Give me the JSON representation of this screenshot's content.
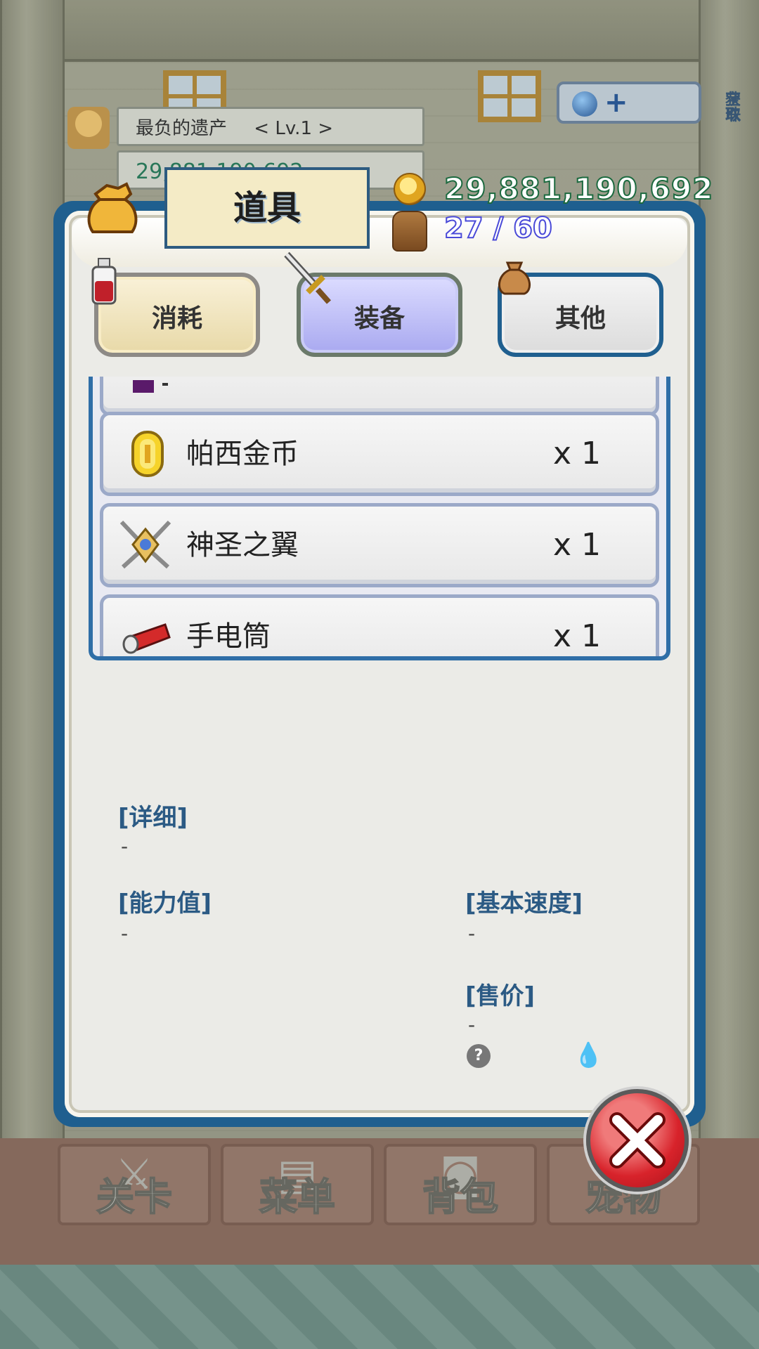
{
  "profile": {
    "title": "最负的遗产",
    "level": "< Lv.1 >",
    "gold_behind": "29,881,190,692"
  },
  "pearl_button": {
    "label_line1": "获取",
    "label_line2": "宝珠"
  },
  "dialog": {
    "title": "道具",
    "gold": "29,881,190,692",
    "capacity": "27 / 60"
  },
  "tabs": [
    {
      "label": "消耗",
      "state": "normal"
    },
    {
      "label": "装备",
      "state": "selected"
    },
    {
      "label": "其他",
      "state": "normal"
    }
  ],
  "items": [
    {
      "name": "帕西金币",
      "qty": "x 1",
      "icon": "gold-coin-icon"
    },
    {
      "name": "神圣之翼",
      "qty": "x 1",
      "icon": "holy-wings-icon"
    },
    {
      "name": "手电筒",
      "qty": "x 1",
      "icon": "flashlight-icon"
    }
  ],
  "details": {
    "detail_label": "[详细]",
    "detail_value": "-",
    "stats_label": "[能力值]",
    "stats_value": "-",
    "speed_label": "[基本速度]",
    "speed_value": "-",
    "price_label": "[售价]",
    "price_value": "-",
    "help_glyph": "?"
  },
  "nav": [
    {
      "label": "关卡",
      "icon": "crossed-swords-icon"
    },
    {
      "label": "菜单",
      "icon": "book-icon"
    },
    {
      "label": "背包",
      "icon": "backpack-icon"
    },
    {
      "label": "宠物",
      "icon": "pet-icon"
    }
  ],
  "colors": {
    "panel_border": "#1f5f8f",
    "gold_text_stroke": "#1c6a3f",
    "capacity_text_stroke": "#4a4ad8",
    "selected_tab": "#a9a9f0",
    "close_button": "#d8232b"
  }
}
